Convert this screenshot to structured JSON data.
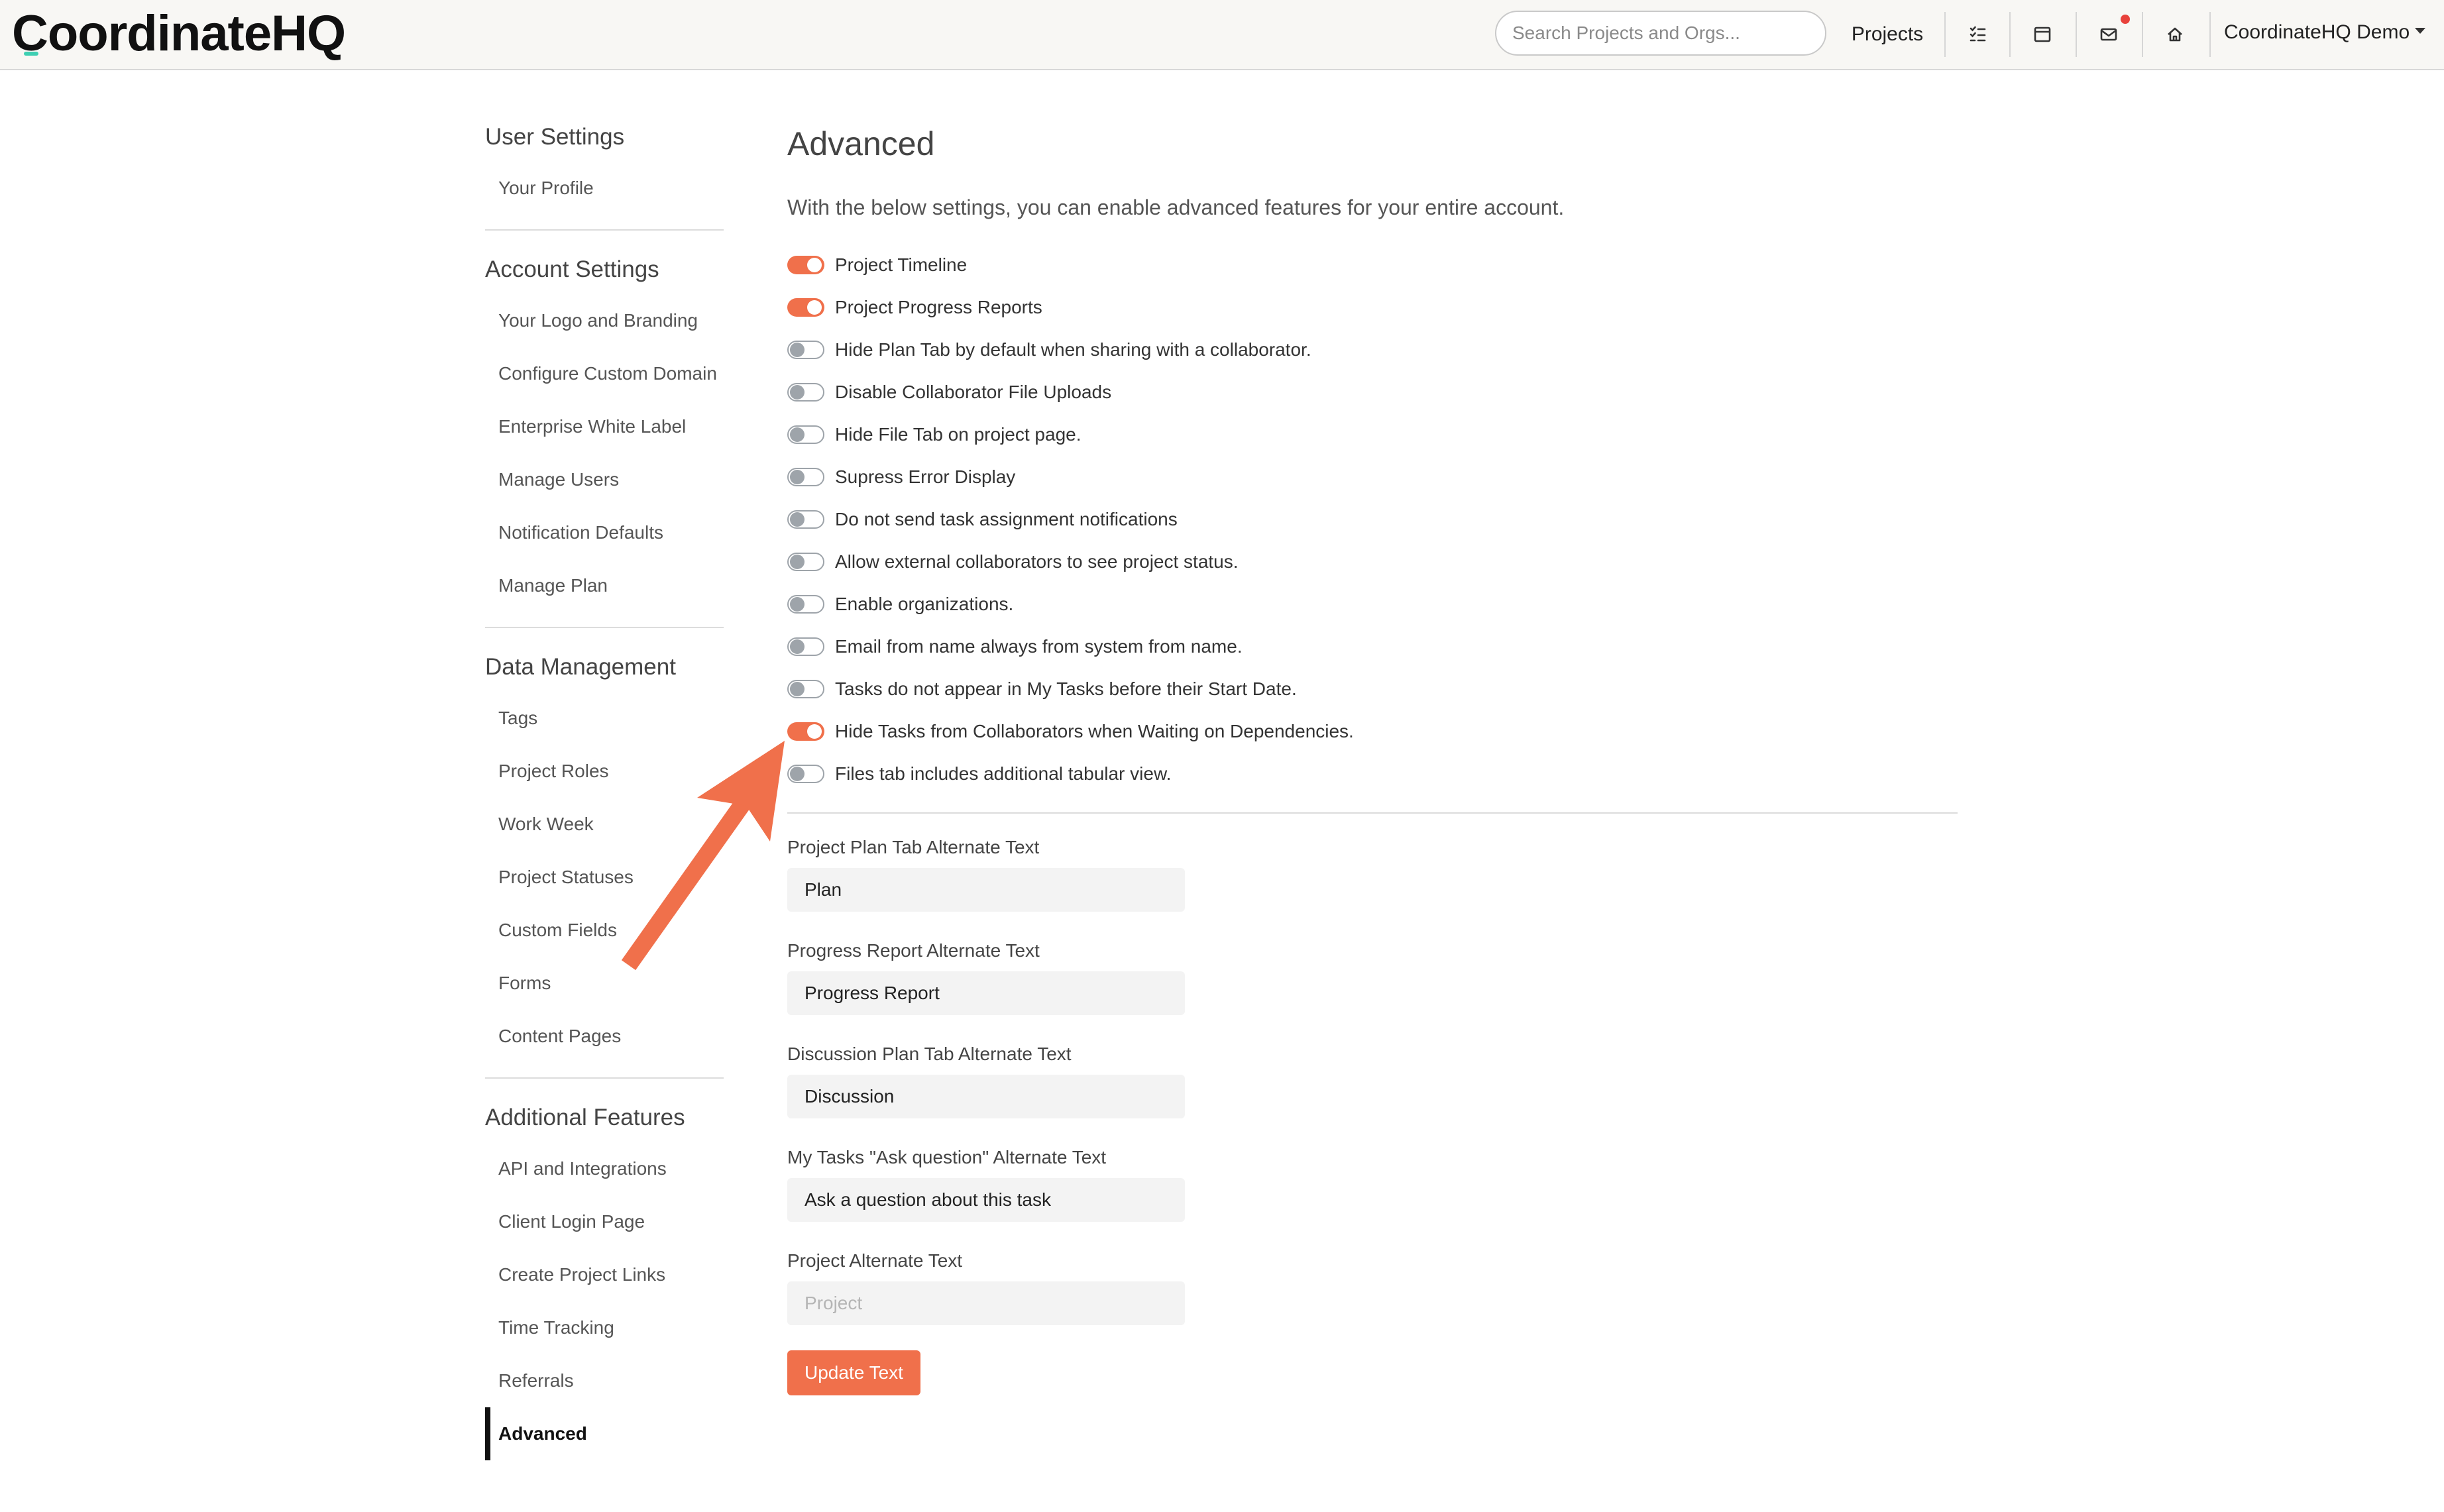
{
  "header": {
    "logo_text": "CoordinateHQ",
    "search_placeholder": "Search Projects and Orgs...",
    "projects_label": "Projects",
    "icons": [
      "checklist-icon",
      "calendar-icon",
      "mail-icon",
      "home-icon"
    ],
    "account_label": "CoordinateHQ Demo"
  },
  "sidebar": {
    "sections": [
      {
        "title": "User Settings",
        "items": [
          "Your Profile"
        ]
      },
      {
        "title": "Account Settings",
        "items": [
          "Your Logo and Branding",
          "Configure Custom Domain",
          "Enterprise White Label",
          "Manage Users",
          "Notification Defaults",
          "Manage Plan"
        ]
      },
      {
        "title": "Data Management",
        "items": [
          "Tags",
          "Project Roles",
          "Work Week",
          "Project Statuses",
          "Custom Fields",
          "Forms",
          "Content Pages"
        ]
      },
      {
        "title": "Additional Features",
        "items": [
          "API and Integrations",
          "Client Login Page",
          "Create Project Links",
          "Time Tracking",
          "Referrals",
          "Advanced"
        ]
      }
    ],
    "active_item": "Advanced"
  },
  "main": {
    "title": "Advanced",
    "description": "With the below settings, you can enable advanced features for your entire account.",
    "toggles": [
      {
        "label": "Project Timeline",
        "on": true
      },
      {
        "label": "Project Progress Reports",
        "on": true
      },
      {
        "label": "Hide Plan Tab by default when sharing with a collaborator.",
        "on": false
      },
      {
        "label": "Disable Collaborator File Uploads",
        "on": false
      },
      {
        "label": "Hide File Tab on project page.",
        "on": false
      },
      {
        "label": "Supress Error Display",
        "on": false
      },
      {
        "label": "Do not send task assignment notifications",
        "on": false
      },
      {
        "label": "Allow external collaborators to see project status.",
        "on": false
      },
      {
        "label": "Enable organizations.",
        "on": false
      },
      {
        "label": "Email from name always from system from name.",
        "on": false
      },
      {
        "label": "Tasks do not appear in My Tasks before their Start Date.",
        "on": false
      },
      {
        "label": "Hide Tasks from Collaborators when Waiting on Dependencies.",
        "on": true
      },
      {
        "label": "Files tab includes additional tabular view.",
        "on": false
      }
    ],
    "fields": [
      {
        "label": "Project Plan Tab Alternate Text",
        "value": "Plan",
        "placeholder": ""
      },
      {
        "label": "Progress Report Alternate Text",
        "value": "Progress Report",
        "placeholder": ""
      },
      {
        "label": "Discussion Plan Tab Alternate Text",
        "value": "Discussion",
        "placeholder": ""
      },
      {
        "label": "My Tasks \"Ask question\" Alternate Text",
        "value": "Ask a question about this task",
        "placeholder": ""
      },
      {
        "label": "Project Alternate Text",
        "value": "",
        "placeholder": "Project"
      }
    ],
    "update_button_label": "Update Text"
  },
  "colors": {
    "accent": "#f0704b",
    "logo_accent": "#3ecfb2",
    "notification_dot": "#e8423b",
    "toggle_off": "#9ea4aa"
  }
}
